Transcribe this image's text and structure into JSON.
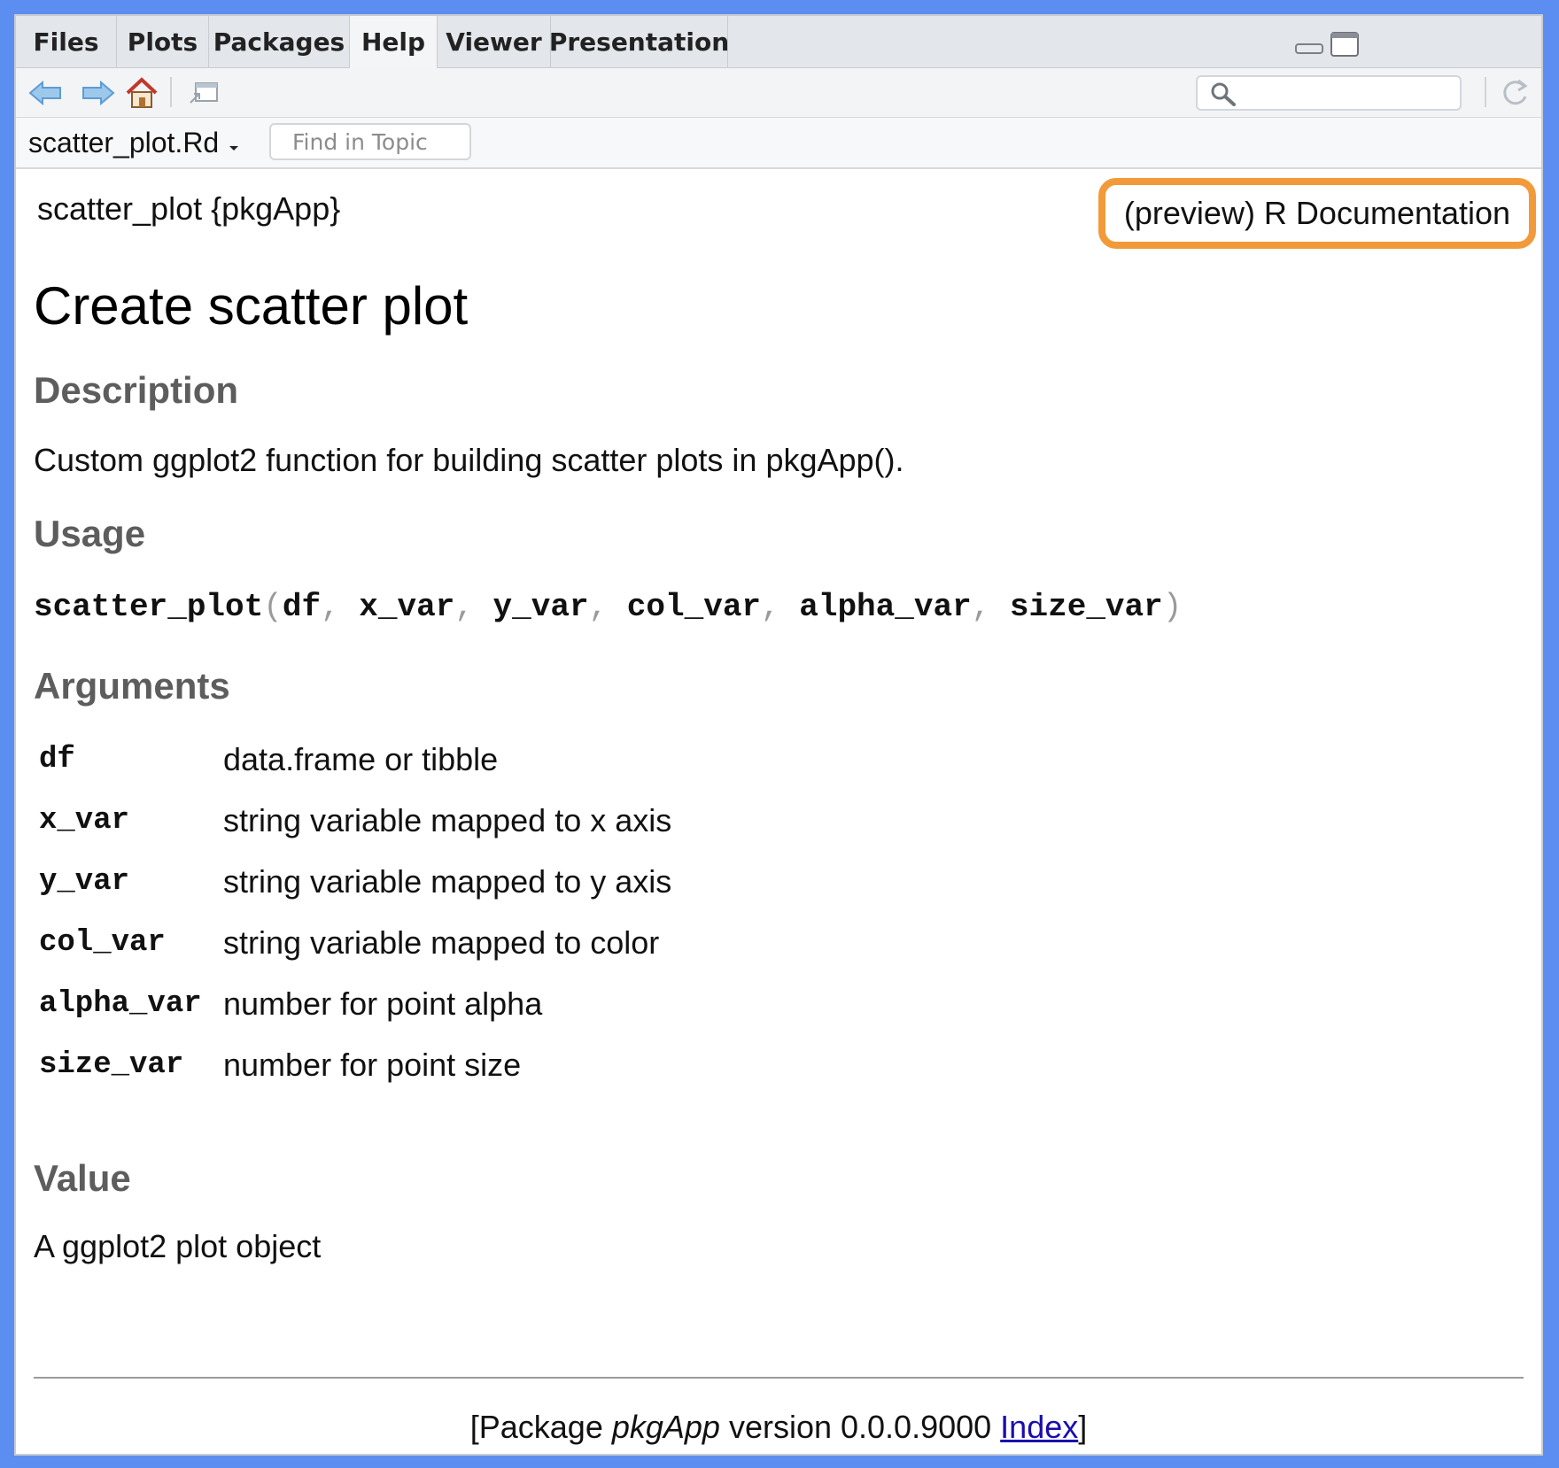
{
  "tabs": [
    {
      "label": "Files",
      "active": false
    },
    {
      "label": "Plots",
      "active": false
    },
    {
      "label": "Packages",
      "active": false
    },
    {
      "label": "Help",
      "active": true
    },
    {
      "label": "Viewer",
      "active": false
    },
    {
      "label": "Presentation",
      "active": false
    }
  ],
  "toolbar": {
    "icons": [
      "back-arrow-icon",
      "forward-arrow-icon",
      "home-icon",
      "popout-icon",
      "search-icon",
      "refresh-icon"
    ]
  },
  "topic_bar": {
    "topic": "scatter_plot.Rd",
    "find_placeholder": "Find in Topic"
  },
  "doc": {
    "header_left": "scatter_plot {pkgApp}",
    "header_right": "(preview) R Documentation",
    "header_right_highlight": "#f29a3a",
    "title": "Create scatter plot",
    "description_heading": "Description",
    "description_text": "Custom ggplot2 function for building scatter plots in pkgApp().",
    "usage_heading": "Usage",
    "usage": {
      "func": "scatter_plot",
      "args": [
        "df",
        "x_var",
        "y_var",
        "col_var",
        "alpha_var",
        "size_var"
      ]
    },
    "arguments_heading": "Arguments",
    "arguments": [
      {
        "name": "df",
        "desc": "data.frame or tibble"
      },
      {
        "name": "x_var",
        "desc": "string variable mapped to x axis"
      },
      {
        "name": "y_var",
        "desc": "string variable mapped to y axis"
      },
      {
        "name": "col_var",
        "desc": "string variable mapped to color"
      },
      {
        "name": "alpha_var",
        "desc": "number for point alpha"
      },
      {
        "name": "size_var",
        "desc": "number for point size"
      }
    ],
    "value_heading": "Value",
    "value_text": "A ggplot2 plot object",
    "footer": {
      "prefix": "[Package ",
      "package": "pkgApp",
      "version_text": " version 0.0.0.9000 ",
      "index_link": "Index",
      "suffix": "]"
    }
  },
  "colors": {
    "frame_bg": "#5b8ef0",
    "link": "#1a0dab",
    "heading": "#5d5d5d"
  }
}
